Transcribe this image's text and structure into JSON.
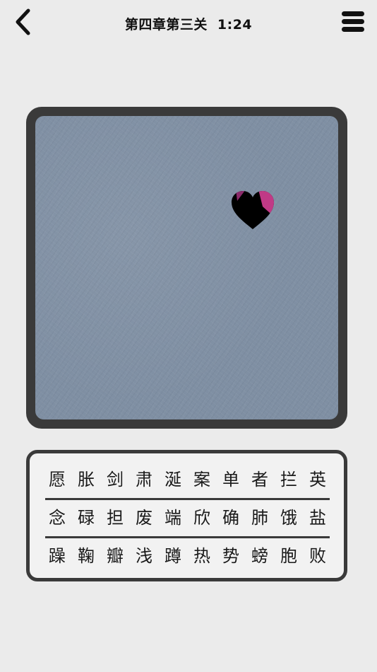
{
  "header": {
    "title": "第四章第三关",
    "timer": "1:24",
    "back_icon": "chevron-left-icon",
    "menu_icon": "hamburger-menu-icon"
  },
  "board": {
    "background_color": "#7f8fa3",
    "frame_color": "#3a3a3a",
    "revealed_piece": "heart-icon",
    "heart_colors": [
      "#000000",
      "#8a2a6a",
      "#c03a86"
    ]
  },
  "characters": {
    "rows": [
      [
        "愿",
        "胀",
        "剑",
        "肃",
        "涎",
        "案",
        "单",
        "者",
        "拦",
        "英"
      ],
      [
        "念",
        "碌",
        "担",
        "废",
        "端",
        "欣",
        "确",
        "肺",
        "饿",
        "盐"
      ],
      [
        "躁",
        "鞠",
        "瓣",
        "浅",
        "蹲",
        "热",
        "势",
        "螃",
        "胞",
        "败"
      ]
    ]
  }
}
